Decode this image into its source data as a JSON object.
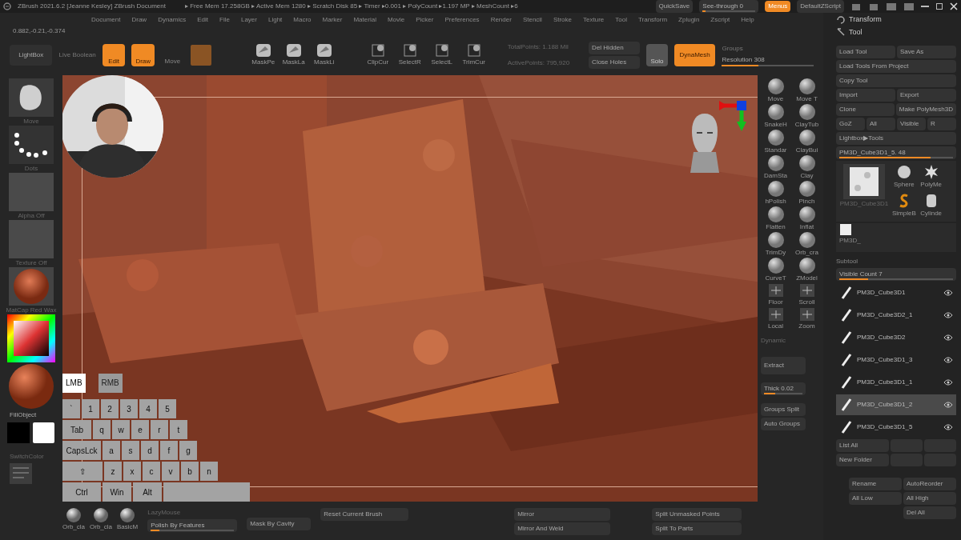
{
  "title_bar": {
    "title": "ZBrush 2021.6.2 [Jeanne Kesley]   ZBrush Document",
    "stats": "▸ Free Mem 17.258GB ▸ Active Mem 1280 ▸ Scratch Disk 85 ▸  Timer ▸0.001 ▸ PolyCount ▸1.197 MP ▸ MeshCount ▸6",
    "quicksave": "QuickSave",
    "see_through": {
      "label": "See-through  0",
      "level": 0.05
    },
    "menus": {
      "label": "Menus",
      "on": true
    },
    "script": "DefaultZScript"
  },
  "menu": [
    "Document",
    "Draw",
    "Dynamics",
    "Edit",
    "File",
    "Layer",
    "Light",
    "Macro",
    "Marker",
    "Material",
    "Movie",
    "Picker",
    "Preferences",
    "Render",
    "Stencil",
    "Stroke",
    "Texture",
    "Tool",
    "Transform",
    "Zplugin",
    "Zscript",
    "Help"
  ],
  "coordinates": "0.882,-0.21,-0.374",
  "toolbar": {
    "lightbox": "LightBox",
    "live_boolean": "Live Boolean",
    "modes": [
      {
        "label": "Edit",
        "on": true
      },
      {
        "label": "Draw",
        "on": true
      },
      {
        "label": "Move",
        "on": false
      }
    ],
    "mask_tools": [
      "MaskPe",
      "MaskLa",
      "MaskLi"
    ],
    "clip_tools": [
      "ClipCur",
      "SelectR",
      "SelectL",
      "TrimCur"
    ],
    "total_points": "TotalPoints: 1.188 Mil",
    "active_points": "ActivePoints: 795,920",
    "del_hidden": "Del Hidden",
    "close_holes": "Close Holes",
    "solo": "Solo",
    "dynamesh": {
      "label": "DynaMesh",
      "on": true
    },
    "groups": "Groups",
    "resolution": {
      "label": "Resolution",
      "value": "308",
      "level": 0.4
    }
  },
  "left_shelf": {
    "brush": "Move",
    "stroke": "Dots",
    "alpha": "Alpha Off",
    "texture": "Texture Off",
    "material": "MatCap Red Wax",
    "fill": "FillObject",
    "switch": "SwitchColor"
  },
  "viewport": {
    "mouse_buttons": [
      {
        "label": "LMB",
        "pressed": true
      },
      {
        "label": "RMB",
        "pressed": false
      }
    ],
    "keyboard": [
      [
        "`",
        "1",
        "2",
        "3",
        "4",
        "5"
      ],
      [
        "Tab",
        "q",
        "w",
        "e",
        "r",
        "t"
      ],
      [
        "CapsLck",
        "a",
        "s",
        "d",
        "f",
        "g"
      ],
      [
        "⇧",
        "z",
        "x",
        "c",
        "v",
        "b",
        "n"
      ],
      [
        "Ctrl",
        "Win",
        "Alt"
      ]
    ]
  },
  "brush_shelf": {
    "brushes": [
      "Move",
      "Move T",
      "SnakeH",
      "ClayTub",
      "Standar",
      "ClayBui",
      "DamSta",
      "Clay",
      "hPolish",
      "Pinch",
      "Flatten",
      "Inflat",
      "TrimDy",
      "Orb_cra",
      "CurveT",
      "ZModel",
      "Floor",
      "Scroll",
      "Local",
      "Zoom"
    ],
    "dynamic": "Dynamic",
    "extract": "Extract",
    "thick": {
      "label": "Thick 0.02",
      "level": 0.3
    },
    "groups_split": "Groups Split",
    "auto_groups": "Auto Groups"
  },
  "tool_panel": {
    "transform": "Transform",
    "tool": "Tool",
    "buttons": [
      [
        "Load Tool",
        "Save As"
      ],
      [
        "Load Tools From Project"
      ],
      [
        "Copy Tool"
      ],
      [
        "Import",
        "Export"
      ],
      [
        "Clone",
        "Make PolyMesh3D"
      ],
      [
        "GoZ",
        "All",
        "Visible",
        "R"
      ],
      [
        "Lightbox▶Tools"
      ]
    ],
    "current": {
      "label": "PM3D_Cube3D1_5. 48",
      "level": 0.8
    },
    "thumbs": [
      "Sphere",
      "PolyMe",
      "SimpleB",
      "Cylinde"
    ],
    "current_thumb": "PM3D_Cube3D1",
    "small_thumb": "PM3D_",
    "subtool": "Subtool",
    "visible_count": {
      "label": "Visible Count 7",
      "level": 0.25
    },
    "subtools": [
      {
        "name": "PM3D_Cube3D1",
        "selected": false
      },
      {
        "name": "PM3D_Cube3D2_1",
        "selected": false
      },
      {
        "name": "PM3D_Cube3D2",
        "selected": false
      },
      {
        "name": "PM3D_Cube3D1_3",
        "selected": false
      },
      {
        "name": "PM3D_Cube3D1_1",
        "selected": false
      },
      {
        "name": "PM3D_Cube3D1_2",
        "selected": true
      },
      {
        "name": "PM3D_Cube3D1_5",
        "selected": false
      }
    ],
    "list_buttons": [
      "List All",
      "New Folder"
    ],
    "bottom_buttons": [
      [
        "Rename",
        "AutoReorder"
      ],
      [
        "All Low",
        "All High"
      ],
      [
        "Del All"
      ]
    ]
  },
  "bottom_bar": {
    "materials": [
      "Orb_cla",
      "Orb_cla",
      "BasicM"
    ],
    "lazy_mouse": "LazyMouse",
    "polish": {
      "label": "Polish By Features",
      "level": 0.1
    },
    "mask_cavity": "Mask By Cavity",
    "reset": "Reset Current Brush",
    "mirror": "Mirror",
    "mirror_weld": "Mirror And Weld",
    "split_unmasked": "Split Unmasked Points",
    "split_parts": "Split To Parts"
  }
}
